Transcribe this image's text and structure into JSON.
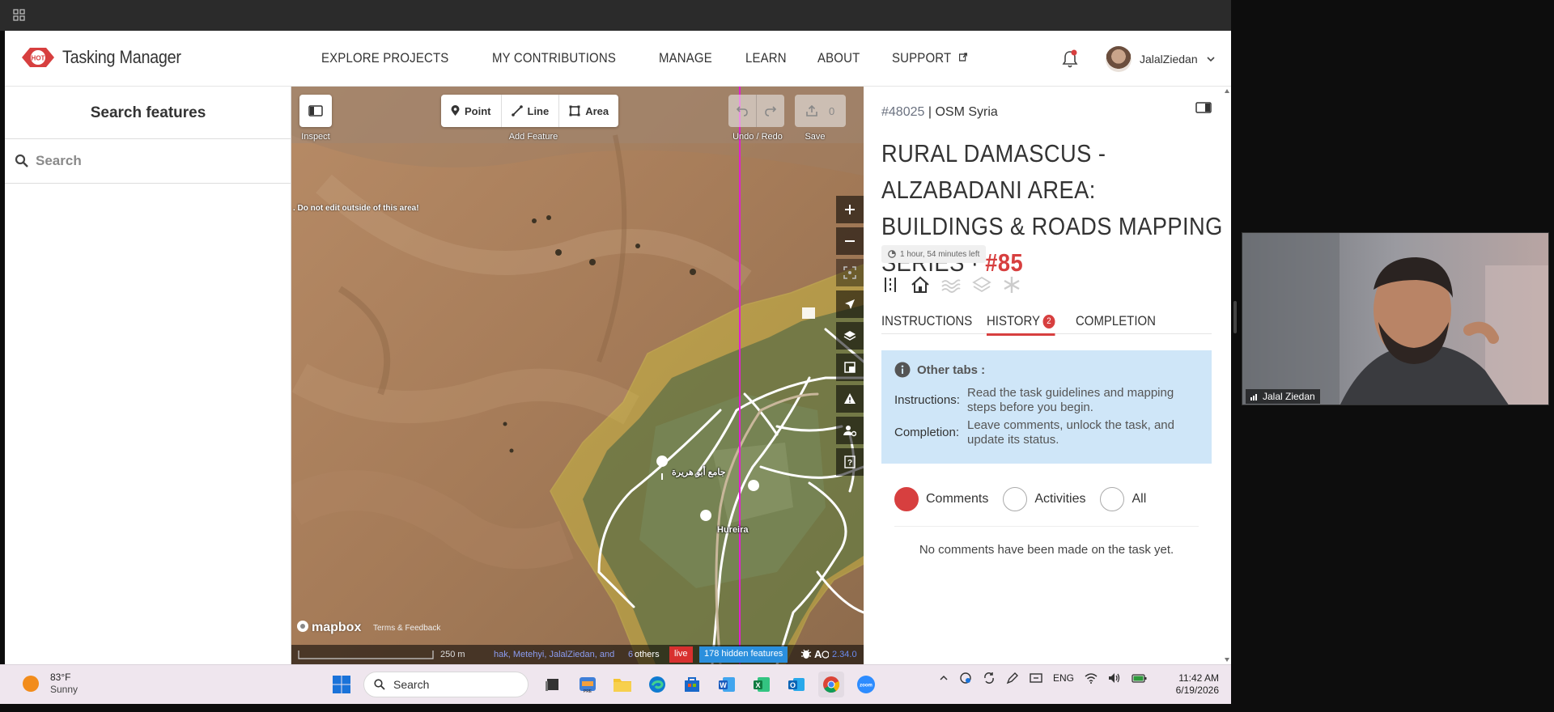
{
  "header": {
    "app_name": "Tasking Manager",
    "nav": [
      "EXPLORE PROJECTS",
      "MY CONTRIBUTIONS",
      "MANAGE",
      "LEARN",
      "ABOUT",
      "SUPPORT"
    ],
    "username": "JalalZiedan"
  },
  "left_panel": {
    "title": "Search features",
    "search_placeholder": "Search"
  },
  "map": {
    "toolbar": {
      "inspect_label": "Inspect",
      "add_feature_label": "Add Feature",
      "point": "Point",
      "line": "Line",
      "area": "Area",
      "undo_redo_label": "Undo / Redo",
      "save_label": "Save",
      "save_count": "0"
    },
    "warning": ". Do not edit outside of this area!",
    "place_labels": [
      "جامع أبو هريرة",
      "Hureira"
    ],
    "attribution": "mapbox",
    "terms": "Terms & Feedback",
    "scale": "250 m",
    "contributors": "hak, Metehyi, JalalZiedan, and",
    "others_count": "6",
    "others_text": "others",
    "live": "live",
    "hidden_features": "178 hidden features",
    "version": "2.34.0"
  },
  "right_panel": {
    "project_id": "#48025",
    "organisation": "OSM Syria",
    "title": "RURAL DAMASCUS - ALZABADANI AREA: BUILDINGS & ROADS MAPPING SERIES",
    "task_sep": "·",
    "task_number": "#85",
    "time_left": "1 hour, 54 minutes left",
    "tabs": {
      "instructions": "INSTRUCTIONS",
      "history": "HISTORY",
      "history_count": "2",
      "completion": "COMPLETION"
    },
    "info": {
      "heading": "Other tabs :",
      "instructions_key": "Instructions:",
      "instructions_val": "Read the task guidelines and mapping steps before you begin.",
      "completion_key": "Completion:",
      "completion_val": "Leave comments, unlock the task, and update its status."
    },
    "filters": [
      "Comments",
      "Activities",
      "All"
    ],
    "no_comments": "No comments have been made on the task yet."
  },
  "taskbar": {
    "temp": "83°F",
    "condition": "Sunny",
    "search": "Search",
    "lang": "ENG",
    "time": "11:42 AM",
    "date": "6/19/2026"
  },
  "webcam": {
    "name": "Jalal Ziedan"
  },
  "colors": {
    "accent_red": "#d73f3f",
    "info_blue": "#cfe6f8",
    "hidden_features_blue": "#2a8fdd",
    "live_red": "#d8302f",
    "task_area_yellow": "#d9d23a",
    "divider_magenta": "#e020d0"
  }
}
